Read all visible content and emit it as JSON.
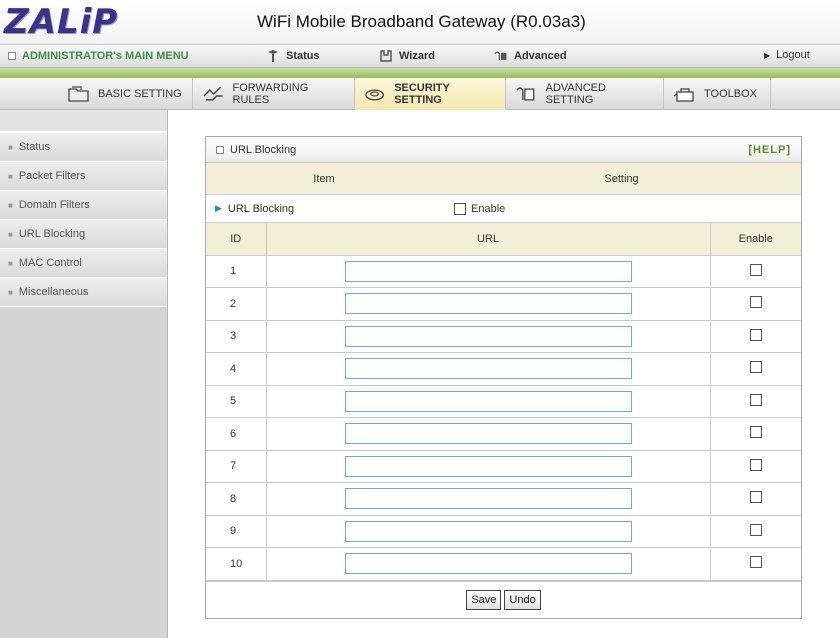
{
  "header": {
    "logo": "ZALiP",
    "title": "WiFi Mobile Broadband Gateway (R0.03a3)"
  },
  "main_menu": {
    "admin": "ADMINISTRATOR's MAIN MENU",
    "status": "Status",
    "wizard": "Wizard",
    "advanced": "Advanced",
    "logout": "Logout"
  },
  "tabs": {
    "basic": "BASIC SETTING",
    "forwarding": "FORWARDING RULES",
    "security": "SECURITY SETTING",
    "advanced": "ADVANCED SETTING",
    "toolbox": "TOOLBOX"
  },
  "sidebar": {
    "items": [
      {
        "label": "Status"
      },
      {
        "label": "Packet Filters"
      },
      {
        "label": "Domain Filters"
      },
      {
        "label": "URL Blocking"
      },
      {
        "label": "MAC Control"
      },
      {
        "label": "Miscellaneous"
      }
    ]
  },
  "panel": {
    "title": "URL Blocking",
    "help": "[HELP]",
    "col_item": "Item",
    "col_setting": "Setting",
    "enable_row_label": "URL Blocking",
    "enable_label": "Enable",
    "enabled": false,
    "table_headers": {
      "id": "ID",
      "url": "URL",
      "enable": "Enable"
    },
    "rows": [
      {
        "id": "1",
        "url": "",
        "enabled": false
      },
      {
        "id": "2",
        "url": "",
        "enabled": false
      },
      {
        "id": "3",
        "url": "",
        "enabled": false
      },
      {
        "id": "4",
        "url": "",
        "enabled": false
      },
      {
        "id": "5",
        "url": "",
        "enabled": false
      },
      {
        "id": "6",
        "url": "",
        "enabled": false
      },
      {
        "id": "7",
        "url": "",
        "enabled": false
      },
      {
        "id": "8",
        "url": "",
        "enabled": false
      },
      {
        "id": "9",
        "url": "",
        "enabled": false
      },
      {
        "id": "10",
        "url": "",
        "enabled": false
      }
    ],
    "save_label": "Save",
    "undo_label": "Undo"
  },
  "colors": {
    "logo": "#3a3488",
    "green_accent": "#8fbd5c",
    "header_bg": "#f3eed8",
    "help_link": "#5a8a2a"
  }
}
